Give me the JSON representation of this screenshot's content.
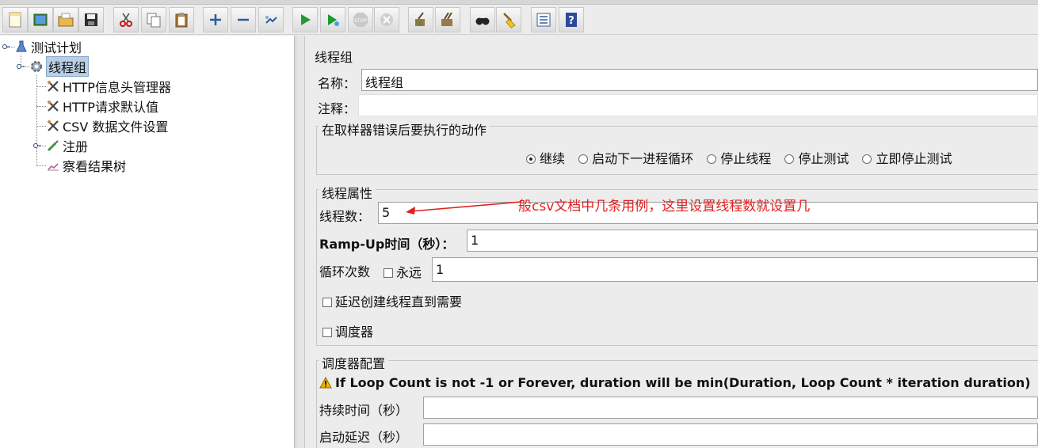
{
  "colors": {
    "accent": "#b8cfe5",
    "annotation": "#e02020",
    "warning": "#f0b400"
  },
  "toolbar": {
    "buttons": [
      {
        "name": "new-icon"
      },
      {
        "name": "templates-icon"
      },
      {
        "name": "open-icon"
      },
      {
        "name": "save-icon"
      },
      {
        "name": "cut-icon"
      },
      {
        "name": "copy-icon"
      },
      {
        "name": "paste-icon"
      },
      {
        "name": "expand-icon"
      },
      {
        "name": "collapse-icon"
      },
      {
        "name": "toggle-icon"
      },
      {
        "name": "start-icon"
      },
      {
        "name": "start-no-pause-icon"
      },
      {
        "name": "stop-icon"
      },
      {
        "name": "shutdown-icon"
      },
      {
        "name": "clear-icon"
      },
      {
        "name": "clear-all-icon"
      },
      {
        "name": "search-icon"
      },
      {
        "name": "reset-search-icon"
      },
      {
        "name": "function-helper-icon"
      },
      {
        "name": "help-icon"
      }
    ]
  },
  "tree": {
    "root": "测试计划",
    "thread_group": "线程组",
    "children": [
      "HTTP信息头管理器",
      "HTTP请求默认值",
      "CSV 数据文件设置",
      "注册",
      "察看结果树"
    ]
  },
  "panel": {
    "title": "线程组",
    "name_label": "名称：",
    "name_value": "线程组",
    "comment_label": "注释：",
    "comment_value": "",
    "error_group_title": "在取样器错误后要执行的动作",
    "error_actions": [
      "继续",
      "启动下一进程循环",
      "停止线程",
      "停止测试",
      "立即停止测试"
    ],
    "error_selected": "继续",
    "thread_group_title": "线程属性",
    "threads_label": "线程数：",
    "threads_value": "5",
    "rampup_label": "Ramp-Up时间（秒）：",
    "rampup_value": "1",
    "loop_label": "循环次数",
    "forever_label": "永远",
    "loop_value": "1",
    "delay_label": "延迟创建线程直到需要",
    "scheduler_label": "调度器",
    "scheduler_group_title": "调度器配置",
    "warning_text": "If Loop Count is not -1 or Forever, duration will be min(Duration, Loop Count * iteration duration)",
    "duration_label": "持续时间（秒）",
    "duration_value": "",
    "startup_delay_label": "启动延迟（秒）",
    "startup_delay_value": ""
  },
  "annotation": {
    "text": "般csv文档中几条用例，这里设置线程数就设置几"
  }
}
